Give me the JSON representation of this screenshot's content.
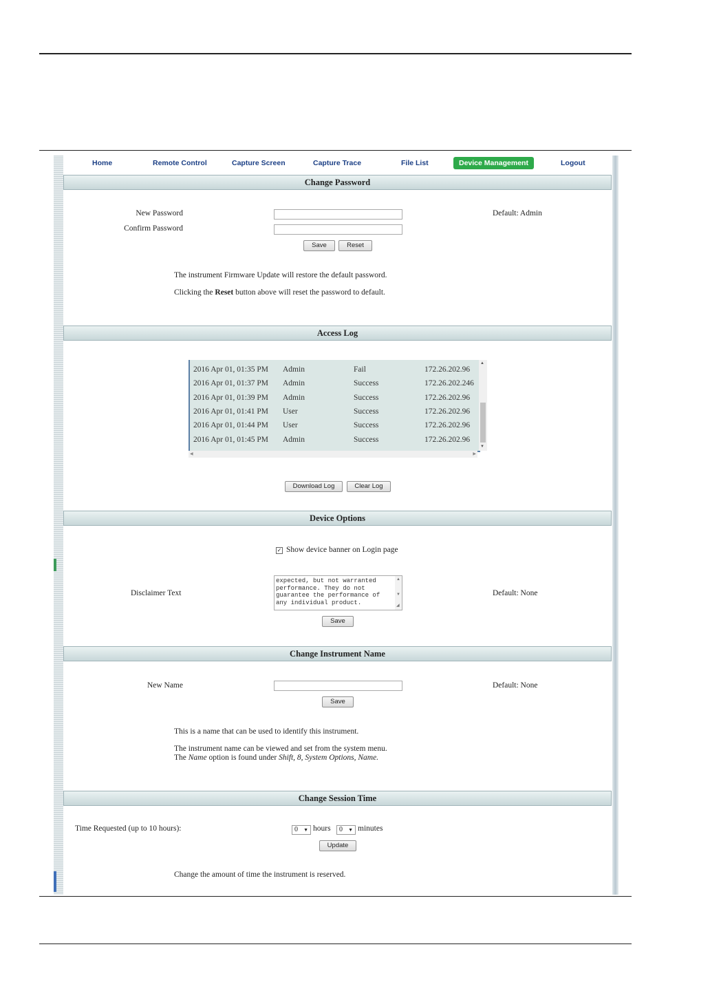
{
  "nav": {
    "home": "Home",
    "remote_control": "Remote Control",
    "capture_screen": "Capture Screen",
    "capture_trace": "Capture Trace",
    "file_list": "File List",
    "device_management": "Device Management",
    "logout": "Logout"
  },
  "change_password": {
    "title": "Change Password",
    "new_password_label": "New Password",
    "confirm_password_label": "Confirm Password",
    "default_text": "Default: Admin",
    "save_label": "Save",
    "reset_label": "Reset",
    "note1": "The instrument Firmware Update will restore the default password.",
    "note2_pre": "Clicking the ",
    "note2_bold": "Reset",
    "note2_post": " button above will reset the password to default."
  },
  "access_log": {
    "title": "Access Log",
    "rows": [
      {
        "date": "2016 Apr 01, 01:35 PM",
        "user": "Admin",
        "result": "Fail",
        "ip": "172.26.202.96"
      },
      {
        "date": "2016 Apr 01, 01:37 PM",
        "user": "Admin",
        "result": "Success",
        "ip": "172.26.202.246"
      },
      {
        "date": "2016 Apr 01, 01:39 PM",
        "user": "Admin",
        "result": "Success",
        "ip": "172.26.202.96"
      },
      {
        "date": "2016 Apr 01, 01:41 PM",
        "user": "User",
        "result": "Success",
        "ip": "172.26.202.96"
      },
      {
        "date": "2016 Apr 01, 01:44 PM",
        "user": "User",
        "result": "Success",
        "ip": "172.26.202.96"
      },
      {
        "date": "2016 Apr 01, 01:45 PM",
        "user": "Admin",
        "result": "Success",
        "ip": "172.26.202.96"
      }
    ],
    "download_label": "Download Log",
    "clear_label": "Clear Log"
  },
  "device_options": {
    "title": "Device Options",
    "banner_checkbox_label": "Show device banner on Login page",
    "banner_checked": true,
    "disclaimer_label": "Disclaimer Text",
    "disclaimer_text": "expected, but not warranted\nperformance. They do not\nguarantee the performance of\nany individual product.",
    "default_text": "Default: None",
    "save_label": "Save"
  },
  "instrument_name": {
    "title": "Change Instrument Name",
    "new_name_label": "New Name",
    "default_text": "Default: None",
    "save_label": "Save",
    "note1": "This is a name that can be used to identify this instrument.",
    "note2": "The instrument name can be viewed and set from the system menu.",
    "note3_pre": "The ",
    "note3_name": "Name",
    "note3_mid": " option is found under ",
    "note3_path": "Shift, 8, System Options, Name."
  },
  "session_time": {
    "title": "Change Session Time",
    "time_label": "Time Requested (up to 10 hours):",
    "hours_value": "0",
    "hours_label": "hours",
    "minutes_value": "0",
    "minutes_label": "minutes",
    "update_label": "Update",
    "note": "Change the amount of time the instrument is reserved."
  }
}
